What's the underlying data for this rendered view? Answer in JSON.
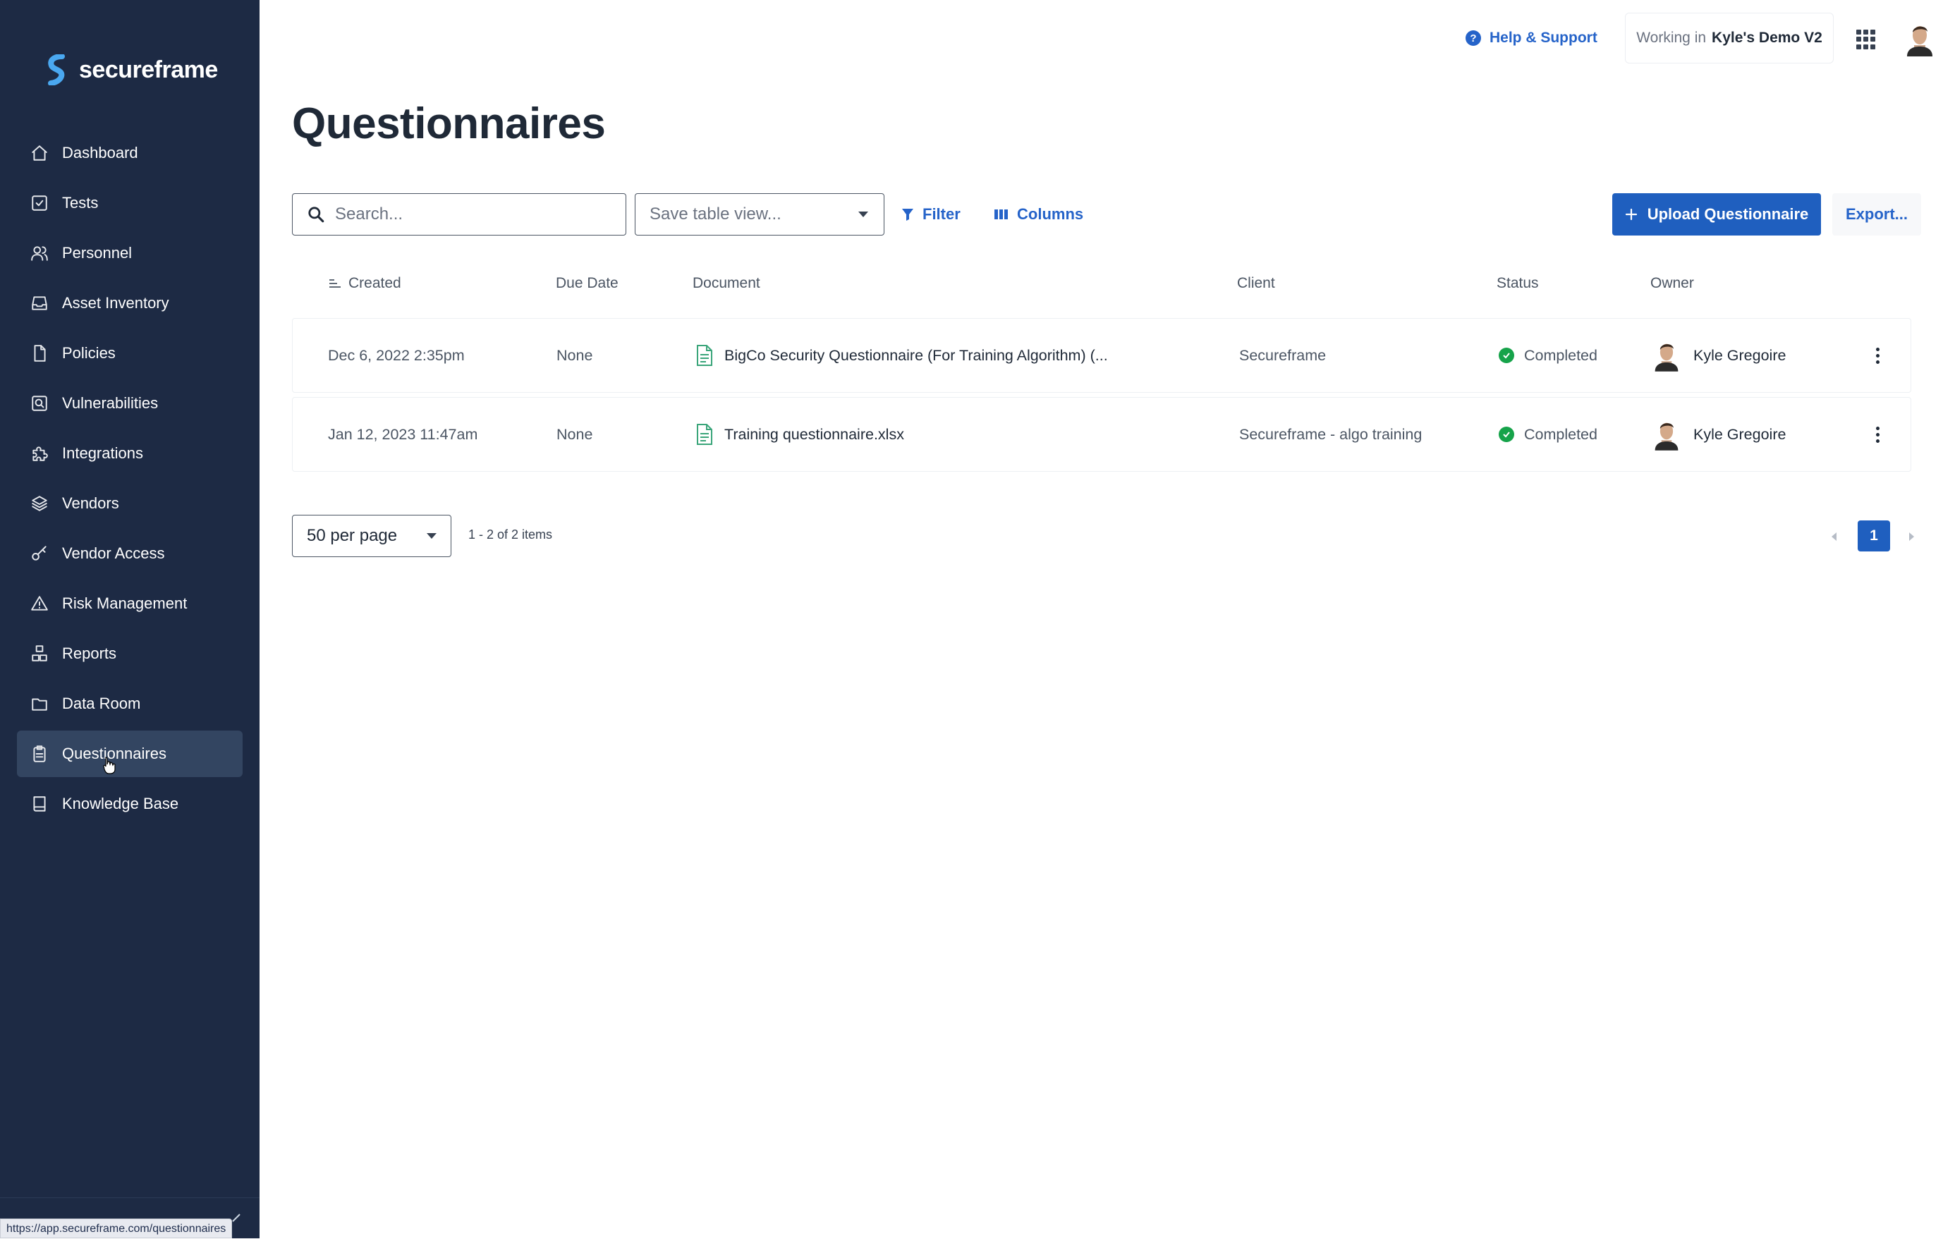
{
  "brand": {
    "name": "secureframe"
  },
  "sidebar": {
    "items": [
      {
        "label": "Dashboard",
        "icon": "home-icon"
      },
      {
        "label": "Tests",
        "icon": "checkbox-icon"
      },
      {
        "label": "Personnel",
        "icon": "people-icon"
      },
      {
        "label": "Asset Inventory",
        "icon": "inbox-icon"
      },
      {
        "label": "Policies",
        "icon": "document-icon"
      },
      {
        "label": "Vulnerabilities",
        "icon": "search-box-icon"
      },
      {
        "label": "Integrations",
        "icon": "puzzle-icon"
      },
      {
        "label": "Vendors",
        "icon": "layers-icon"
      },
      {
        "label": "Vendor Access",
        "icon": "key-icon"
      },
      {
        "label": "Risk Management",
        "icon": "warning-icon"
      },
      {
        "label": "Reports",
        "icon": "blocks-icon"
      },
      {
        "label": "Data Room",
        "icon": "folder-icon"
      },
      {
        "label": "Questionnaires",
        "icon": "clipboard-icon",
        "active": true
      },
      {
        "label": "Knowledge Base",
        "icon": "book-icon"
      }
    ],
    "status_url": "https://app.secureframe.com/questionnaires"
  },
  "topbar": {
    "help_label": "Help & Support",
    "workspace_prefix": "Working in",
    "workspace_name": "Kyle's Demo V2"
  },
  "page": {
    "title": "Questionnaires"
  },
  "toolbar": {
    "search_placeholder": "Search...",
    "save_view_placeholder": "Save table view...",
    "filter_label": "Filter",
    "columns_label": "Columns",
    "upload_label": "Upload Questionnaire",
    "export_label": "Export..."
  },
  "table": {
    "columns": {
      "created": "Created",
      "due_date": "Due Date",
      "document": "Document",
      "client": "Client",
      "status": "Status",
      "owner": "Owner"
    },
    "rows": [
      {
        "created": "Dec 6, 2022 2:35pm",
        "due_date": "None",
        "document": "BigCo Security Questionnaire (For Training Algorithm) (...",
        "client": "Secureframe",
        "status": "Completed",
        "owner": "Kyle Gregoire"
      },
      {
        "created": "Jan 12, 2023 11:47am",
        "due_date": "None",
        "document": "Training questionnaire.xlsx",
        "client": "Secureframe - algo training",
        "status": "Completed",
        "owner": "Kyle Gregoire"
      }
    ]
  },
  "pagination": {
    "per_page": "50 per page",
    "items_label": "1 - 2 of 2 items",
    "current_page": "1"
  },
  "colors": {
    "sidebar_bg": "#1d2a44",
    "accent": "#1f5fbf",
    "link": "#2563c9",
    "success": "#16a34a",
    "doc_icon": "#3aa57a"
  }
}
